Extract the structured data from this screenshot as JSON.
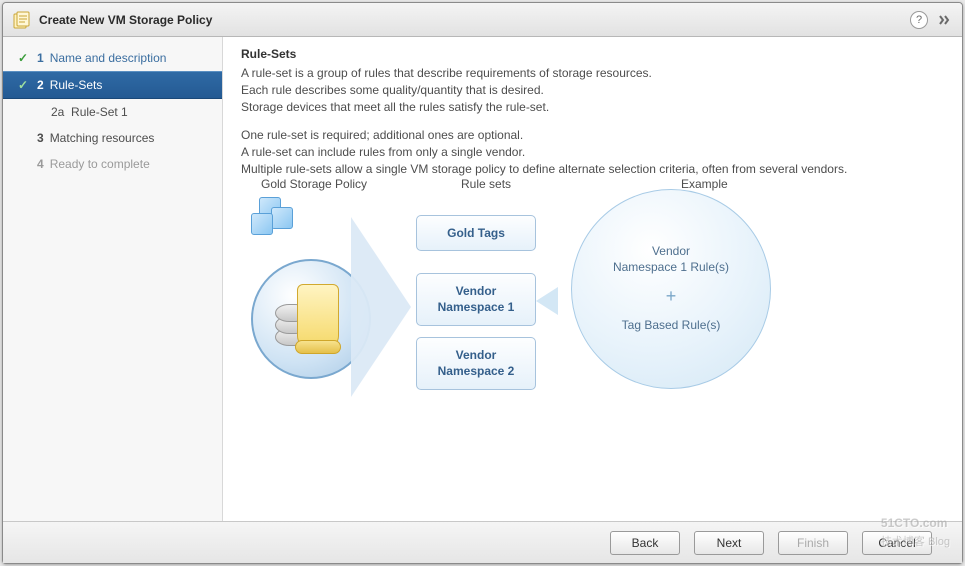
{
  "title": "Create New VM Storage Policy",
  "steps": [
    {
      "num": "1",
      "label": "Name and description",
      "state": "completed"
    },
    {
      "num": "2",
      "label": "Rule-Sets",
      "state": "active"
    },
    {
      "num": "2a",
      "label": "Rule-Set 1",
      "state": "sub"
    },
    {
      "num": "3",
      "label": "Matching resources",
      "state": "future"
    },
    {
      "num": "4",
      "label": "Ready to complete",
      "state": "disabled"
    }
  ],
  "content": {
    "heading": "Rule-Sets",
    "p1a": "A rule-set is a group of rules that describe requirements of storage resources.",
    "p1b": "Each rule describes some quality/quantity that is desired.",
    "p1c": "Storage devices that meet all the rules satisfy the rule-set.",
    "p2a": "One rule-set is required; additional ones are optional.",
    "p2b": "A rule-set can include rules from only a single vendor.",
    "p2c": "Multiple rule-sets allow a single VM storage policy to define alternate selection criteria, often from several vendors."
  },
  "diagram": {
    "goldLabel": "Gold Storage Policy",
    "ruleLabel": "Rule sets",
    "exampleLabel": "Example",
    "tags": {
      "gold": "Gold Tags",
      "v1a": "Vendor",
      "v1b": "Namespace 1",
      "v2a": "Vendor",
      "v2b": "Namespace 2"
    },
    "example": {
      "line1a": "Vendor",
      "line1b": "Namespace 1 Rule(s)",
      "plus": "+",
      "line2": "Tag Based Rule(s)"
    }
  },
  "buttons": {
    "back": "Back",
    "next": "Next",
    "finish": "Finish",
    "cancel": "Cancel"
  },
  "watermark": {
    "main": "51CTO.com",
    "sub": "技术博客   Blog"
  }
}
